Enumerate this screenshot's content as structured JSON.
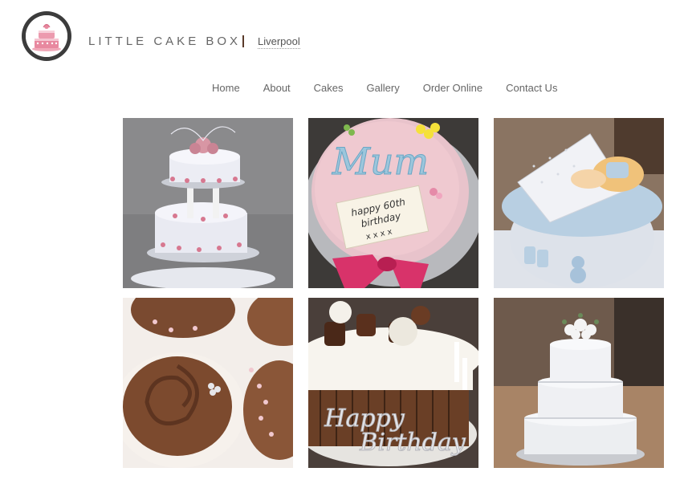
{
  "header": {
    "brand": "LITTLE CAKE BOX",
    "city": "Liverpool",
    "logo_icon": "cake-logo-icon"
  },
  "nav": {
    "items": [
      "Home",
      "About",
      "Cakes",
      "Gallery",
      "Order Online",
      "Contact Us"
    ]
  },
  "gallery": {
    "images": [
      {
        "name": "two-tier-pink-wedding-cake"
      },
      {
        "name": "mum-60th-birthday-cake",
        "text": [
          "Mum",
          "happy 60th",
          "birthday",
          "x x x x"
        ]
      },
      {
        "name": "baby-cradle-cake"
      },
      {
        "name": "chocolate-rose-cupcakes"
      },
      {
        "name": "chocolate-happy-birthday-cake",
        "text": [
          "Happy",
          "Birthday"
        ]
      },
      {
        "name": "three-tier-white-wedding-cake"
      }
    ]
  },
  "colors": {
    "accent_pink": "#e8889f",
    "text_gray": "#666666",
    "logo_ring": "#3c3c3c"
  }
}
